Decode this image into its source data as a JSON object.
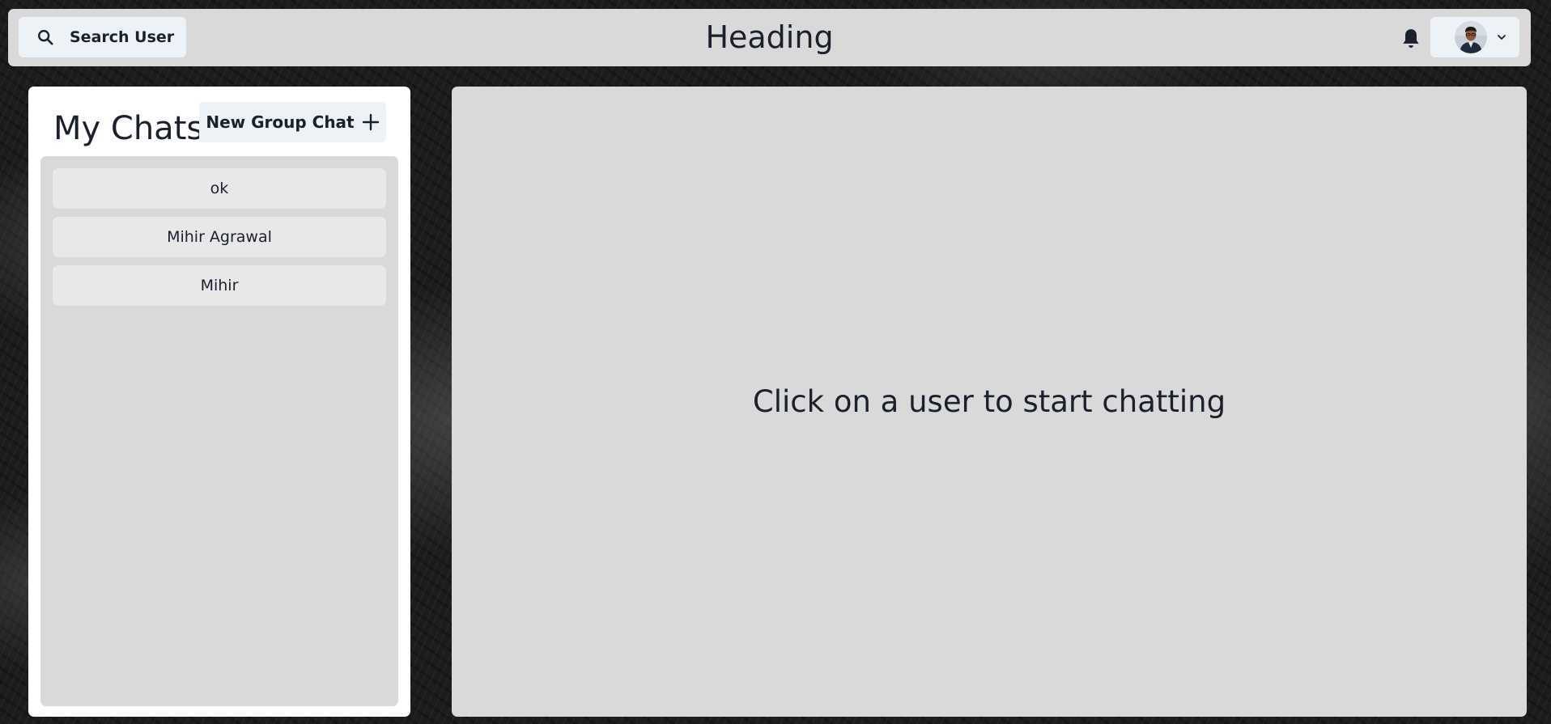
{
  "header": {
    "search_label": "Search User",
    "title": "Heading",
    "icons": {
      "search": "search-icon",
      "notifications": "bell-icon",
      "profile_menu": "chevron-down-icon"
    }
  },
  "sidebar": {
    "title": "My Chats",
    "new_group_label": "New Group Chat",
    "new_group_icon": "plus-icon",
    "chats": [
      {
        "name": "ok"
      },
      {
        "name": "Mihir Agrawal"
      },
      {
        "name": "Mihir"
      }
    ]
  },
  "main": {
    "empty_message": "Click on a user to start chatting"
  },
  "colors": {
    "panel": "#d9d9d9",
    "button": "#edf2f7",
    "chat_item": "#e8e8e8",
    "text": "#1a202c"
  }
}
